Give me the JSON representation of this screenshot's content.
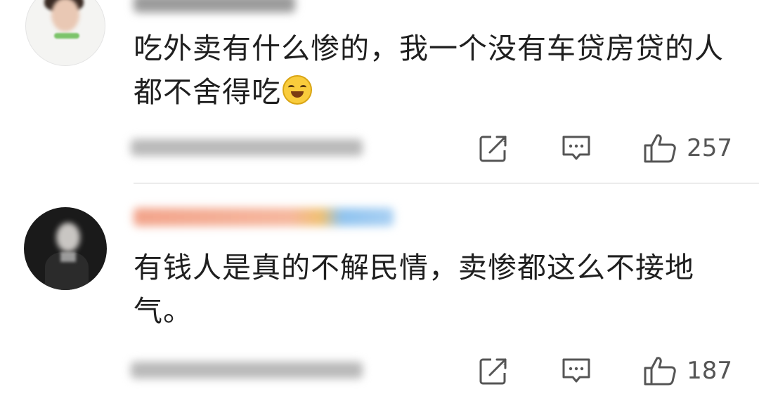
{
  "comments": [
    {
      "text": "吃外卖有什么惨的，我一个没有车贷房贷的人都不舍得吃",
      "emoji": "crying-laughing-emoji",
      "likes": "257"
    },
    {
      "text": "有钱人是真的不解民情，卖惨都这么不接地气。",
      "likes": "187"
    }
  ],
  "icons": {
    "share": "share-edit-icon",
    "reply": "comment-icon",
    "like": "thumbs-up-icon"
  },
  "colors": {
    "text": "#1f1f1f",
    "icon": "#555555",
    "divider": "#ececec"
  }
}
